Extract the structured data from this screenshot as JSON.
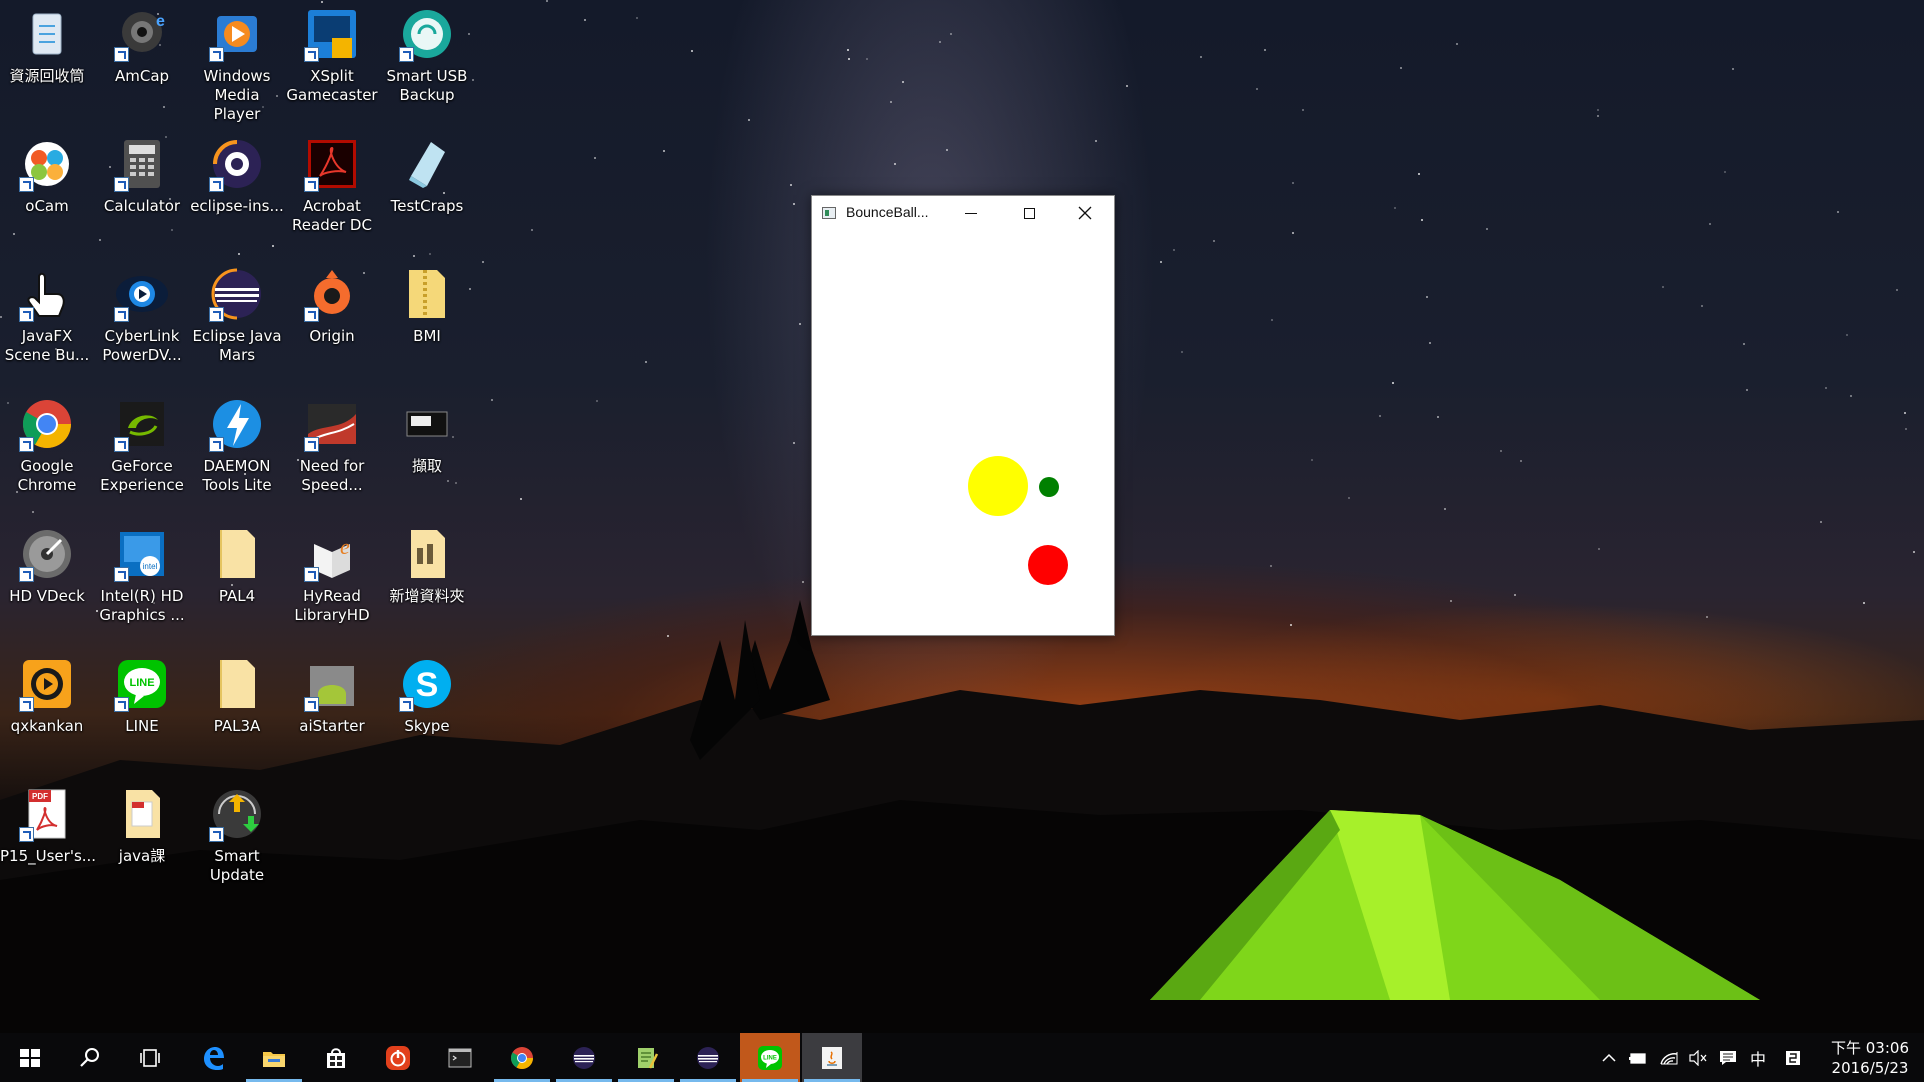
{
  "desktop": {
    "icons": [
      {
        "label": "資源回收筒"
      },
      {
        "label": "AmCap"
      },
      {
        "label": "Windows Media Player"
      },
      {
        "label": "XSplit Gamecaster"
      },
      {
        "label": "Smart USB Backup"
      },
      {
        "label": "oCam"
      },
      {
        "label": "Calculator"
      },
      {
        "label": "eclipse-ins..."
      },
      {
        "label": "Acrobat Reader DC"
      },
      {
        "label": "TestCraps"
      },
      {
        "label": "JavaFX Scene Bu..."
      },
      {
        "label": "CyberLink PowerDV..."
      },
      {
        "label": "Eclipse Java Mars"
      },
      {
        "label": "Origin"
      },
      {
        "label": "BMI"
      },
      {
        "label": "Google Chrome"
      },
      {
        "label": "GeForce Experience"
      },
      {
        "label": "DAEMON Tools Lite"
      },
      {
        "label": "Need for Speed..."
      },
      {
        "label": "擷取"
      },
      {
        "label": "HD VDeck"
      },
      {
        "label": "Intel(R) HD Graphics ..."
      },
      {
        "label": "PAL4"
      },
      {
        "label": "HyRead LibraryHD"
      },
      {
        "label": "新增資料夾"
      },
      {
        "label": "qxkankan"
      },
      {
        "label": "LINE"
      },
      {
        "label": "PAL3A"
      },
      {
        "label": "aiStarter"
      },
      {
        "label": "Skype"
      },
      {
        "label": "P15_User's..."
      },
      {
        "label": "java課"
      },
      {
        "label": "Smart Update"
      }
    ]
  },
  "window": {
    "title": "BounceBall...",
    "balls": [
      {
        "name": "yellow-ball",
        "color": "#ffff00"
      },
      {
        "name": "green-ball",
        "color": "#008000"
      },
      {
        "name": "red-ball",
        "color": "#ff0000"
      }
    ]
  },
  "taskbar": {
    "apps": [
      "start",
      "search",
      "task-view",
      "edge",
      "file-explorer",
      "store",
      "power",
      "terminal",
      "chrome",
      "eclipse",
      "notepad",
      "eclipse-2",
      "line",
      "java"
    ],
    "tray": {
      "time": "下午 03:06",
      "date": "2016/5/23",
      "ime": "中"
    }
  }
}
